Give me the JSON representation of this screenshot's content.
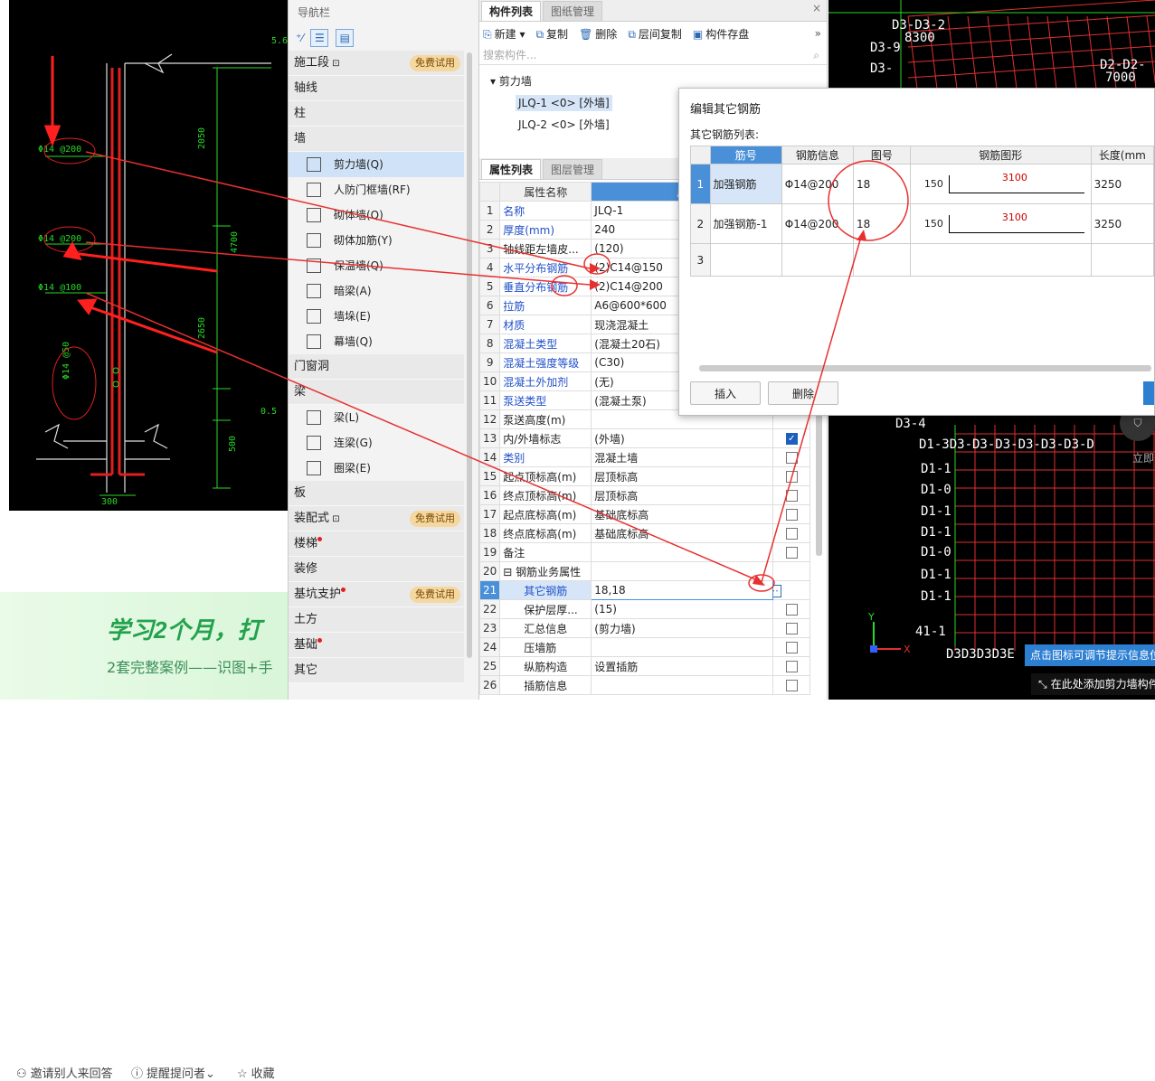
{
  "left_drawing": {
    "labels": {
      "top_right": "5.6",
      "rebar1": "Φ14 @200",
      "rebar2": "Φ14 @200",
      "rebar3": "Φ14 @100",
      "rebar4": "Φ14 @50",
      "dim1": "2050",
      "dim2": "4700",
      "dim3": "2650",
      "dim4": "500",
      "dim5": "0.5",
      "width": "300"
    }
  },
  "qa_bar": {
    "invite": "邀请别人来回答",
    "remind": "提醒提问者",
    "collect": "收藏"
  },
  "banner": {
    "headline": "学习2个月，打",
    "subline": "2套完整案例——识图+手"
  },
  "nav": {
    "title": "导航栏",
    "categories": [
      {
        "label": "施工段",
        "trial": "免费试用"
      },
      {
        "label": "轴线"
      },
      {
        "label": "柱"
      },
      {
        "label": "墙"
      },
      {
        "label": "门窗洞"
      },
      {
        "label": "梁"
      },
      {
        "label": "板"
      },
      {
        "label": "装配式",
        "trial": "免费试用"
      },
      {
        "label": "楼梯"
      },
      {
        "label": "装修"
      },
      {
        "label": "基坑支护",
        "trial": "免费试用"
      },
      {
        "label": "土方"
      },
      {
        "label": "基础"
      },
      {
        "label": "其它"
      }
    ],
    "wall_items": [
      "剪力墙(Q)",
      "人防门框墙(RF)",
      "砌体墙(Q)",
      "砌体加筋(Y)",
      "保温墙(Q)",
      "暗梁(A)",
      "墙垛(E)",
      "幕墙(Q)"
    ],
    "beam_items": [
      "梁(L)",
      "连梁(G)",
      "圈梁(E)"
    ]
  },
  "component": {
    "tab_list": "构件列表",
    "tab_drawing": "图纸管理",
    "toolbar": {
      "new": "新建",
      "copy": "复制",
      "delete": "删除",
      "layer_copy": "层间复制",
      "save": "构件存盘"
    },
    "search_placeholder": "搜索构件...",
    "tree_root": "剪力墙",
    "items": [
      "JLQ-1 <0> [外墙]",
      "JLQ-2 <0> [外墙]"
    ]
  },
  "property": {
    "tab_props": "属性列表",
    "tab_layers": "图层管理",
    "col_name": "属性名称",
    "col_value": "属",
    "rows": [
      {
        "no": "1",
        "name": "名称",
        "value": "JLQ-1",
        "blue": true
      },
      {
        "no": "2",
        "name": "厚度(mm)",
        "value": "240",
        "blue": true
      },
      {
        "no": "3",
        "name": "轴线距左墙皮...",
        "value": "(120)"
      },
      {
        "no": "4",
        "name": "水平分布钢筋",
        "value": "(2)C14@150",
        "blue": true
      },
      {
        "no": "5",
        "name": "垂直分布钢筋",
        "value": "(2)C14@200",
        "blue": true
      },
      {
        "no": "6",
        "name": "拉筋",
        "value": "A6@600*600",
        "blue": true
      },
      {
        "no": "7",
        "name": "材质",
        "value": "现浇混凝土",
        "blue": true
      },
      {
        "no": "8",
        "name": "混凝土类型",
        "value": "(混凝土20石)",
        "blue": true
      },
      {
        "no": "9",
        "name": "混凝土强度等级",
        "value": "(C30)",
        "blue": true
      },
      {
        "no": "10",
        "name": "混凝土外加剂",
        "value": "(无)",
        "blue": true
      },
      {
        "no": "11",
        "name": "泵送类型",
        "value": "(混凝土泵)",
        "blue": true
      },
      {
        "no": "12",
        "name": "泵送高度(m)",
        "value": ""
      },
      {
        "no": "13",
        "name": "内/外墙标志",
        "value": "(外墙)",
        "check": "on"
      },
      {
        "no": "14",
        "name": "类别",
        "value": "混凝土墙",
        "blue": true,
        "check": "off"
      },
      {
        "no": "15",
        "name": "起点顶标高(m)",
        "value": "层顶标高",
        "check": "off"
      },
      {
        "no": "16",
        "name": "终点顶标高(m)",
        "value": "层顶标高",
        "check": "off"
      },
      {
        "no": "17",
        "name": "起点底标高(m)",
        "value": "基础底标高",
        "check": "off"
      },
      {
        "no": "18",
        "name": "终点底标高(m)",
        "value": "基础底标高",
        "check": "off"
      },
      {
        "no": "19",
        "name": "备注",
        "value": "",
        "check": "off"
      },
      {
        "no": "20",
        "name": "⊟ 钢筋业务属性",
        "value": ""
      },
      {
        "no": "21",
        "name": "其它钢筋",
        "value": "18,18",
        "indent": true,
        "sel": true
      },
      {
        "no": "22",
        "name": "保护层厚...",
        "value": "(15)",
        "indent": true,
        "check": "off"
      },
      {
        "no": "23",
        "name": "汇总信息",
        "value": "(剪力墙)",
        "indent": true,
        "check": "off"
      },
      {
        "no": "24",
        "name": "压墙筋",
        "value": "",
        "indent": true,
        "check": "off"
      },
      {
        "no": "25",
        "name": "纵筋构造",
        "value": "设置插筋",
        "indent": true,
        "check": "off"
      },
      {
        "no": "26",
        "name": "插筋信息",
        "value": "",
        "indent": true,
        "check": "off"
      }
    ]
  },
  "dialog": {
    "title": "编辑其它钢筋",
    "list_label": "其它钢筋列表:",
    "headers": [
      "筋号",
      "钢筋信息",
      "图号",
      "钢筋图形",
      "长度(mm"
    ],
    "rows": [
      {
        "no": "1",
        "name": "加强钢筋",
        "info": "Φ14@200",
        "fig": "18",
        "left": "150",
        "len": "3100",
        "total": "3250"
      },
      {
        "no": "2",
        "name": "加强钢筋-1",
        "info": "Φ14@200",
        "fig": "18",
        "left": "150",
        "len": "3100",
        "total": "3250"
      },
      {
        "no": "3",
        "name": "",
        "info": "",
        "fig": "",
        "left": "",
        "len": "",
        "total": ""
      }
    ],
    "insert": "插入",
    "delete": "删除"
  },
  "right_drawing": {
    "labels": [
      "D3-D3-2",
      "8300",
      "D3-9",
      "D3-",
      "D2-D2-",
      "7000",
      "D3-4",
      "D1-3D3-D3-D3-D3-D3-D3-D",
      "D1-1",
      "D1-0",
      "D1-1",
      "D1-1",
      "D1-0",
      "D1-1",
      "D1-1",
      "41-1",
      "D3D3D3D3E"
    ],
    "hint": "点击图标可调节提示信息位",
    "hint2": "在此处添加剪力墙构件",
    "side_label": "立即"
  },
  "colors": {
    "accent": "#4a90d9",
    "red_annot": "#e83030",
    "cad_green": "#28d828",
    "grid_red": "#e03030"
  }
}
